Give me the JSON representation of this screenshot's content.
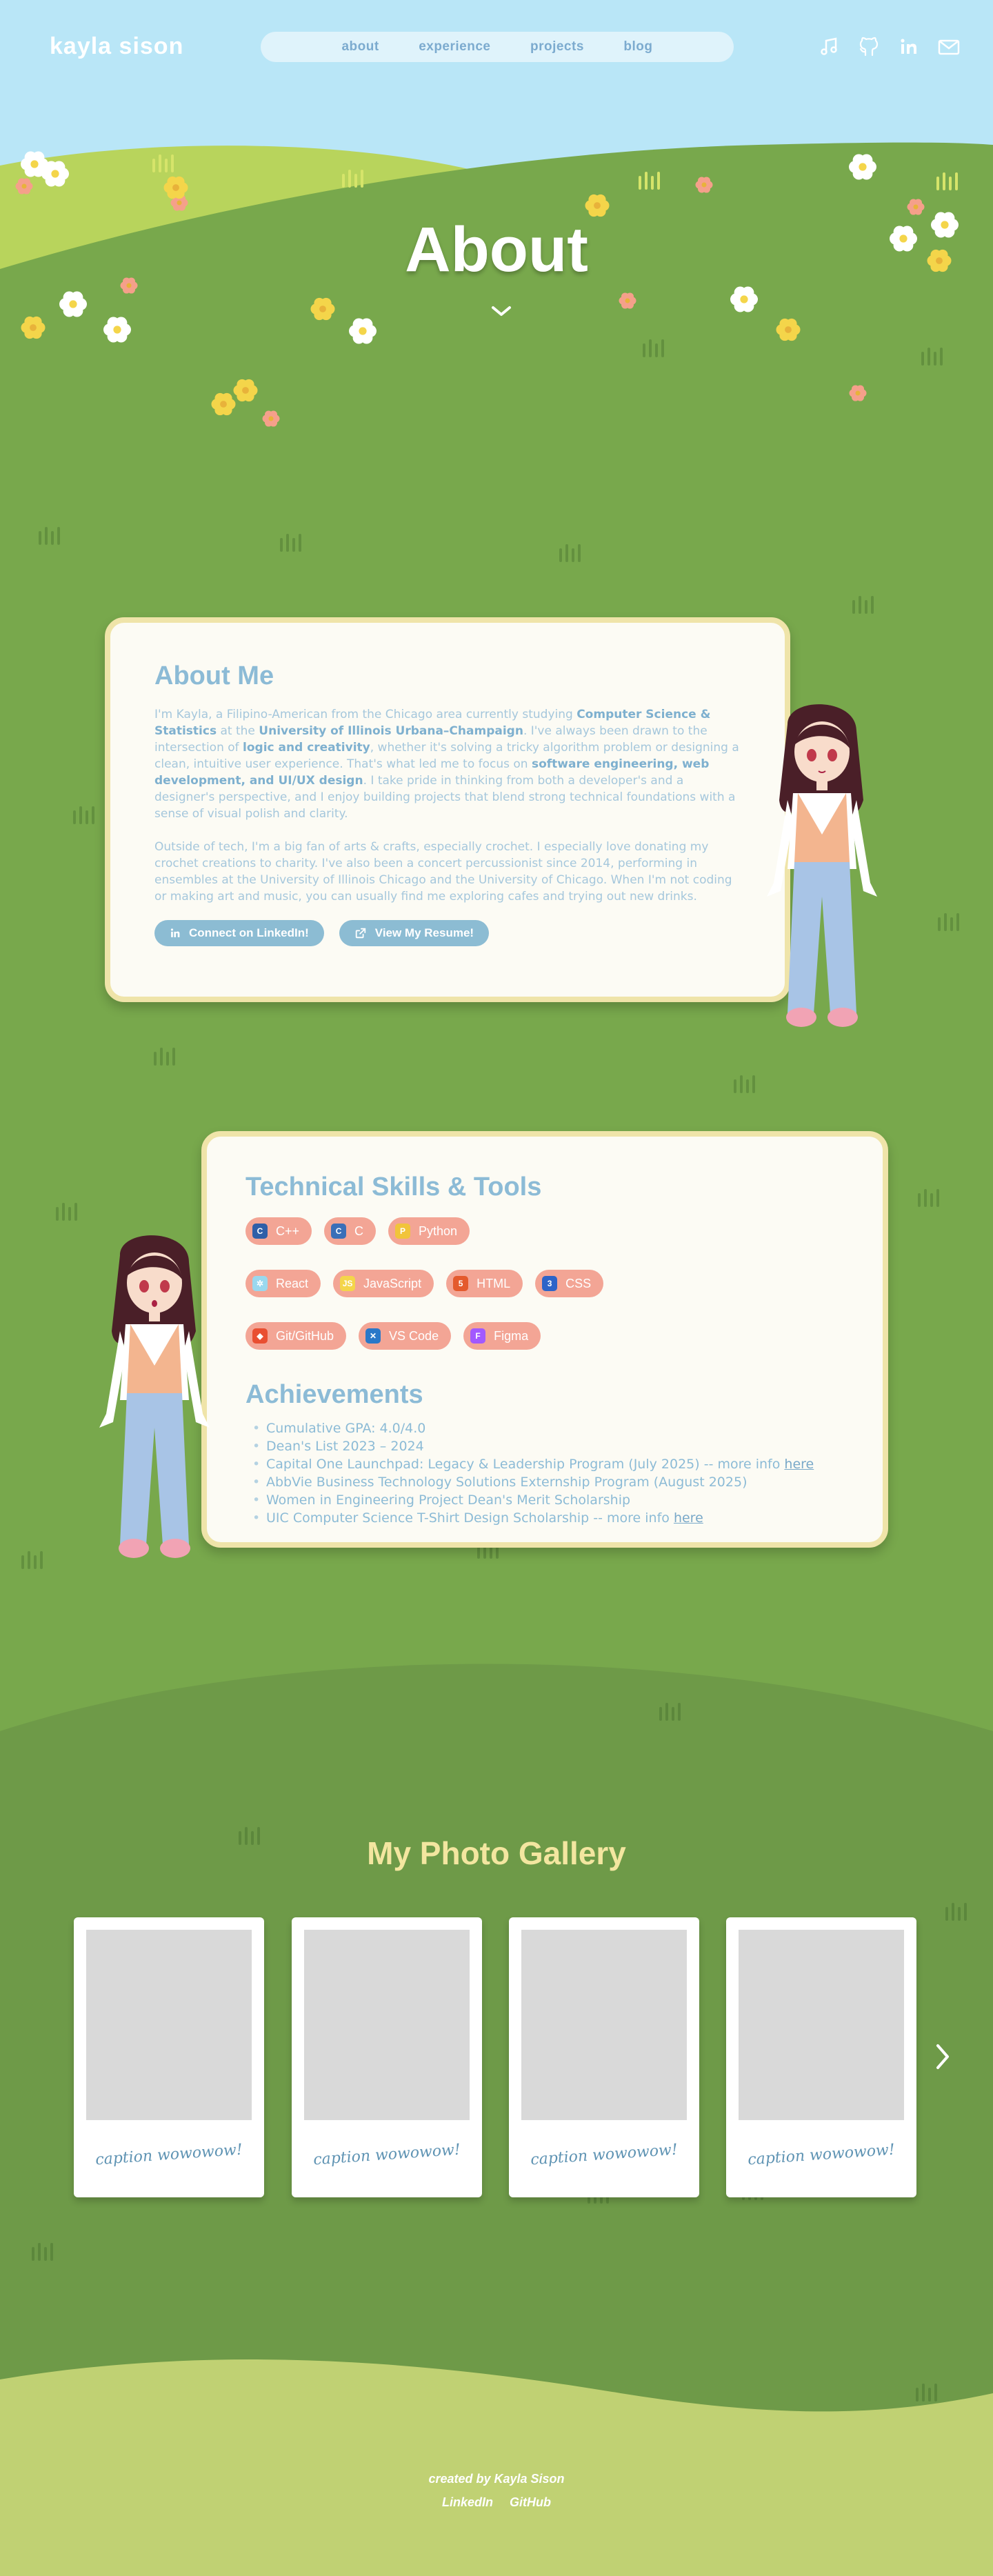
{
  "header": {
    "site_title": "kayla sison",
    "nav": [
      "about",
      "experience",
      "projects",
      "blog"
    ],
    "social_icons": [
      "music-icon",
      "github-icon",
      "linkedin-icon",
      "mail-icon"
    ]
  },
  "hero": {
    "title": "About"
  },
  "about_me": {
    "heading": "About Me",
    "paragraph1": [
      {
        "t": "I'm Kayla, a Filipino-American from the Chicago area currently studying ",
        "b": false
      },
      {
        "t": "Computer Science & Statistics",
        "b": true
      },
      {
        "t": " at the ",
        "b": false
      },
      {
        "t": "University of Illinois Urbana–Champaign",
        "b": true
      },
      {
        "t": ". I've always been drawn to the intersection of ",
        "b": false
      },
      {
        "t": "logic and creativity",
        "b": true
      },
      {
        "t": ", whether it's solving a tricky algorithm problem or designing a clean, intuitive user experience. That's what led me to focus on ",
        "b": false
      },
      {
        "t": "software engineering, web development, and UI/UX design",
        "b": true
      },
      {
        "t": ". I take pride in thinking from both a developer's and a designer's perspective, and I enjoy building projects that blend strong technical foundations with a sense of visual polish and clarity.",
        "b": false
      }
    ],
    "paragraph2": "Outside of tech, I'm a big fan of arts & crafts, especially crochet.  I especially love donating my crochet creations to charity. I've also been a concert percussionist since 2014, performing in ensembles at the University of Illinois Chicago and the University of Chicago. When I'm not coding or making art and music, you can usually find me exploring cafes and trying out new drinks.",
    "linkedin_button": "Connect on LinkedIn!",
    "resume_button": "View My Resume!"
  },
  "skills": {
    "heading": "Technical Skills & Tools",
    "rows": [
      [
        {
          "label": "C++",
          "icon": "cpp-icon",
          "color": "#2f5fa8",
          "glyph": "C"
        },
        {
          "label": "C",
          "icon": "c-icon",
          "color": "#3a6fb8",
          "glyph": "C"
        },
        {
          "label": "Python",
          "icon": "python-icon",
          "color": "#f1c43a",
          "glyph": "P"
        }
      ],
      [
        {
          "label": "React",
          "icon": "react-icon",
          "color": "#9ad8ee",
          "glyph": "✲"
        },
        {
          "label": "JavaScript",
          "icon": "javascript-icon",
          "color": "#f4d54a",
          "glyph": "JS"
        },
        {
          "label": "HTML",
          "icon": "html-icon",
          "color": "#e45a2d",
          "glyph": "5"
        },
        {
          "label": "CSS",
          "icon": "css-icon",
          "color": "#2d64c8",
          "glyph": "3"
        }
      ],
      [
        {
          "label": "Git/GitHub",
          "icon": "git-icon",
          "color": "#e94f31",
          "glyph": "◆"
        },
        {
          "label": "VS Code",
          "icon": "vscode-icon",
          "color": "#2b78c8",
          "glyph": "✕"
        },
        {
          "label": "Figma",
          "icon": "figma-icon",
          "color": "#a259ff",
          "glyph": "F"
        }
      ]
    ]
  },
  "achievements": {
    "heading": "Achievements",
    "items": [
      {
        "text": "Cumulative GPA: 4.0/4.0",
        "link": ""
      },
      {
        "text": "Dean's List 2023 – 2024",
        "link": ""
      },
      {
        "text": "Capital One Launchpad: Legacy & Leadership Program (July 2025) -- more info ",
        "link": "here"
      },
      {
        "text": "AbbVie Business Technology Solutions Externship Program (August 2025)",
        "link": ""
      },
      {
        "text": "Women in Engineering Project Dean's Merit Scholarship",
        "link": ""
      },
      {
        "text": "UIC Computer Science T-Shirt Design Scholarship -- more info ",
        "link": "here"
      }
    ]
  },
  "gallery": {
    "title": "My Photo Gallery",
    "captions": [
      "caption wowowow!",
      "caption wowowow!",
      "caption wowowow!",
      "caption wowowow!"
    ],
    "next_label": "›"
  },
  "footer": {
    "credit": "created by Kayla Sison",
    "links": [
      "LinkedIn",
      "GitHub"
    ]
  },
  "colors": {
    "sky": "#b9e6f7",
    "meadow": "#78a84c",
    "card_border": "#efe4a9",
    "accent_blue": "#8cbbd6",
    "chip_salmon": "#f3a595",
    "gallery_title": "#f3e6a0",
    "footer_hill": "#c0d173"
  }
}
